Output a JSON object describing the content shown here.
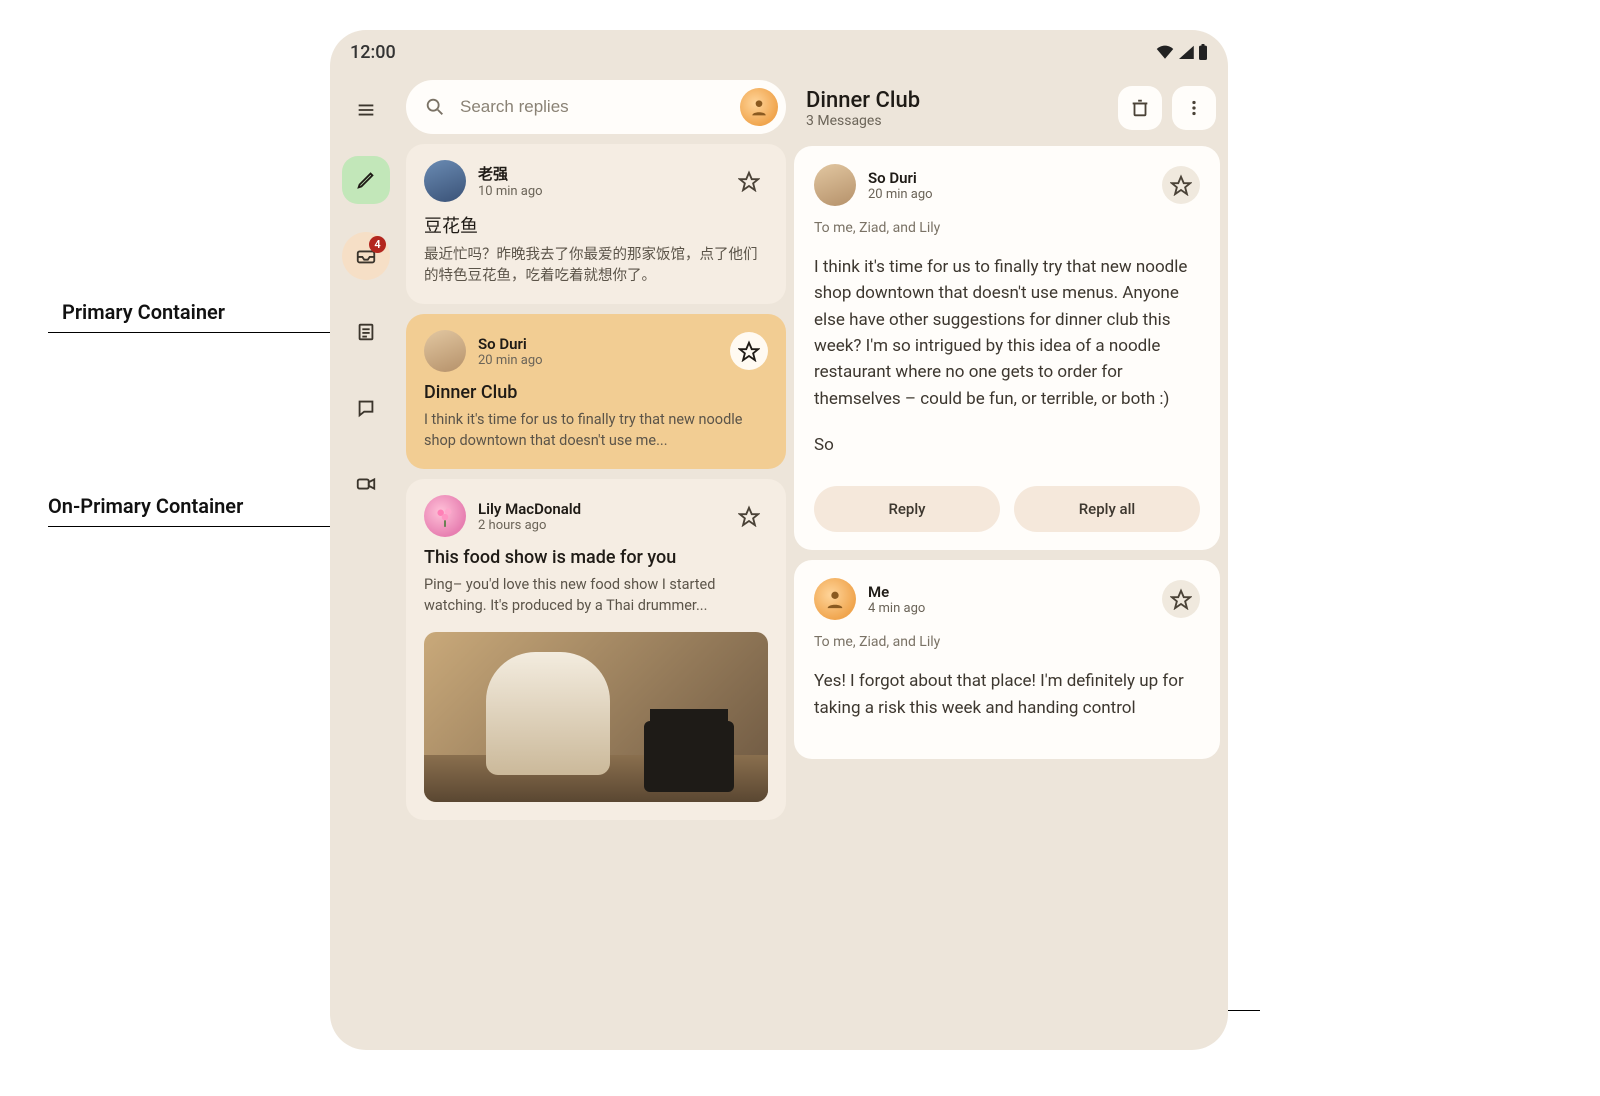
{
  "annotations": {
    "primary": "Primary Container",
    "on_primary": "On-Primary Container"
  },
  "status": {
    "time": "12:00"
  },
  "nav": {
    "badge": "4"
  },
  "search": {
    "placeholder": "Search replies"
  },
  "list": [
    {
      "sender": "老强",
      "time": "10 min ago",
      "subject": "豆花鱼",
      "preview": "最近忙吗？昨晚我去了你最爱的那家饭馆，点了他们的特色豆花鱼，吃着吃着就想你了。"
    },
    {
      "sender": "So Duri",
      "time": "20 min ago",
      "subject": "Dinner Club",
      "preview": "I think it's time for us to finally try that new noodle shop downtown that doesn't use me..."
    },
    {
      "sender": "Lily MacDonald",
      "time": "2 hours ago",
      "subject": "This food show is made for you",
      "preview": "Ping– you'd love this new food show I started watching. It's produced by a Thai drummer..."
    }
  ],
  "detail": {
    "title": "Dinner Club",
    "subtitle": "3 Messages",
    "messages": [
      {
        "sender": "So Duri",
        "time": "20 min ago",
        "recipients": "To me, Ziad, and Lily",
        "body": "I think it's time for us to finally try that new noodle shop downtown that doesn't use menus. Anyone else have other suggestions for dinner club this week? I'm so intrigued by this idea of a noodle restaurant where no one gets to order for themselves – could be fun, or terrible, or both :)",
        "signature": "So"
      },
      {
        "sender": "Me",
        "time": "4 min ago",
        "recipients": "To me, Ziad, and Lily",
        "body": "Yes! I forgot about that place! I'm definitely up for taking a risk this week and handing control"
      }
    ],
    "reply_label": "Reply",
    "reply_all_label": "Reply all"
  }
}
